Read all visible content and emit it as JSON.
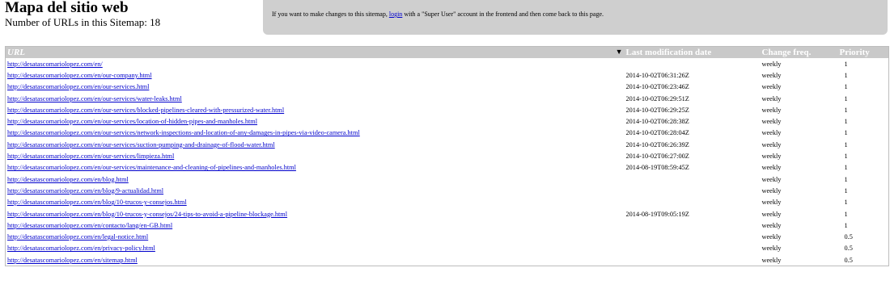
{
  "header": {
    "title": "Mapa del sitio web",
    "count_text": "Number of URLs in this Sitemap: 18"
  },
  "notice": {
    "before": "If you want to make changes to this sitemap, ",
    "link": "login",
    "after": " with a \"Super User\" account in the frontend and then come back to this page."
  },
  "table": {
    "headers": {
      "url": "URL",
      "sort_icon": "▼",
      "lastmod": "Last modification date",
      "changefreq": "Change freq.",
      "priority": "Priority"
    },
    "rows": [
      {
        "url": "http://desatascomariolopez.com/en/",
        "lastmod": "",
        "changefreq": "weekly",
        "priority": "1"
      },
      {
        "url": "http://desatascomariolopez.com/en/our-company.html",
        "lastmod": "2014-10-02T06:31:26Z",
        "changefreq": "weekly",
        "priority": "1"
      },
      {
        "url": "http://desatascomariolopez.com/en/our-services.html",
        "lastmod": "2014-10-02T06:23:46Z",
        "changefreq": "weekly",
        "priority": "1"
      },
      {
        "url": "http://desatascomariolopez.com/en/our-services/water-leaks.html",
        "lastmod": "2014-10-02T06:29:51Z",
        "changefreq": "weekly",
        "priority": "1"
      },
      {
        "url": "http://desatascomariolopez.com/en/our-services/blocked-pipelines-cleared-with-pressurized-water.html",
        "lastmod": "2014-10-02T06:29:25Z",
        "changefreq": "weekly",
        "priority": "1"
      },
      {
        "url": "http://desatascomariolopez.com/en/our-services/location-of-hidden-pipes-and-manholes.html",
        "lastmod": "2014-10-02T06:28:38Z",
        "changefreq": "weekly",
        "priority": "1"
      },
      {
        "url": "http://desatascomariolopez.com/en/our-services/network-inspections-and-location-of-any-damages-in-pipes-via-video-camera.html",
        "lastmod": "2014-10-02T06:28:04Z",
        "changefreq": "weekly",
        "priority": "1"
      },
      {
        "url": "http://desatascomariolopez.com/en/our-services/suction-pumping-and-drainage-of-flood-water.html",
        "lastmod": "2014-10-02T06:26:39Z",
        "changefreq": "weekly",
        "priority": "1"
      },
      {
        "url": "http://desatascomariolopez.com/en/our-services/limpieza.html",
        "lastmod": "2014-10-02T06:27:00Z",
        "changefreq": "weekly",
        "priority": "1"
      },
      {
        "url": "http://desatascomariolopez.com/en/our-services/maintenance-and-cleaning-of-pipelines-and-manholes.html",
        "lastmod": "2014-08-19T08:59:45Z",
        "changefreq": "weekly",
        "priority": "1"
      },
      {
        "url": "http://desatascomariolopez.com/en/blog.html",
        "lastmod": "",
        "changefreq": "weekly",
        "priority": "1"
      },
      {
        "url": "http://desatascomariolopez.com/en/blog/9-actualidad.html",
        "lastmod": "",
        "changefreq": "weekly",
        "priority": "1"
      },
      {
        "url": "http://desatascomariolopez.com/en/blog/10-trucos-y-consejos.html",
        "lastmod": "",
        "changefreq": "weekly",
        "priority": "1"
      },
      {
        "url": "http://desatascomariolopez.com/en/blog/10-trucos-y-consejos/24-tips-to-avoid-a-pipeline-blockage.html",
        "lastmod": "2014-08-19T09:05:19Z",
        "changefreq": "weekly",
        "priority": "1"
      },
      {
        "url": "http://desatascomariolopez.com/en/contacto/lang/en-GB.html",
        "lastmod": "",
        "changefreq": "weekly",
        "priority": "1"
      },
      {
        "url": "http://desatascomariolopez.com/en/legal-notice.html",
        "lastmod": "",
        "changefreq": "weekly",
        "priority": "0.5"
      },
      {
        "url": "http://desatascomariolopez.com/en/privacy-policy.html",
        "lastmod": "",
        "changefreq": "weekly",
        "priority": "0.5"
      },
      {
        "url": "http://desatascomariolopez.com/en/sitemap.html",
        "lastmod": "",
        "changefreq": "weekly",
        "priority": "0.5"
      }
    ]
  }
}
